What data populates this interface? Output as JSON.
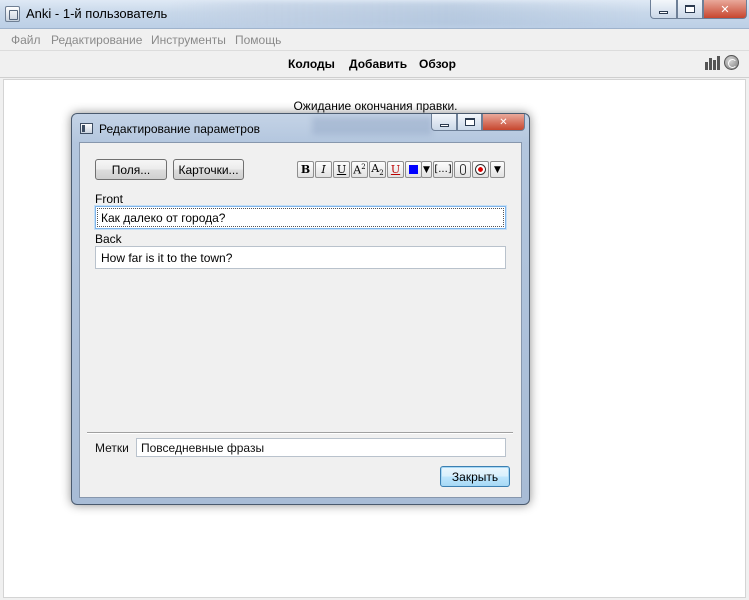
{
  "window": {
    "title": "Anki - 1-й пользователь"
  },
  "menu": {
    "items": [
      "Файл",
      "Редактирование",
      "Инструменты",
      "Помощь"
    ]
  },
  "toolbar": {
    "decks": "Колоды",
    "add": "Добавить",
    "browse": "Обзор",
    "icons": [
      "stats-icon",
      "sync-icon"
    ]
  },
  "status": {
    "waiting": "Ожидание окончания правки."
  },
  "dialog": {
    "title": "Редактирование параметров",
    "fields_button": "Поля...",
    "cards_button": "Карточки...",
    "format_buttons": {
      "bold": "B",
      "italic": "I",
      "underline": "U",
      "superscript": "A",
      "subscript": "A",
      "color_menu": "▼",
      "cloze": "[...]",
      "more": "▼"
    },
    "fields": [
      {
        "label": "Front",
        "value": "Как далеко от города?"
      },
      {
        "label": "Back",
        "value": "How far is it to the town?"
      }
    ],
    "tags_label": "Метки",
    "tags_value": "Повседневные фразы",
    "close_button": "Закрыть"
  },
  "colors": {
    "text_color_swatch": "#0000ff",
    "close_button_red": "#c7462e",
    "titlebar_blue": "#c8d8ea"
  }
}
